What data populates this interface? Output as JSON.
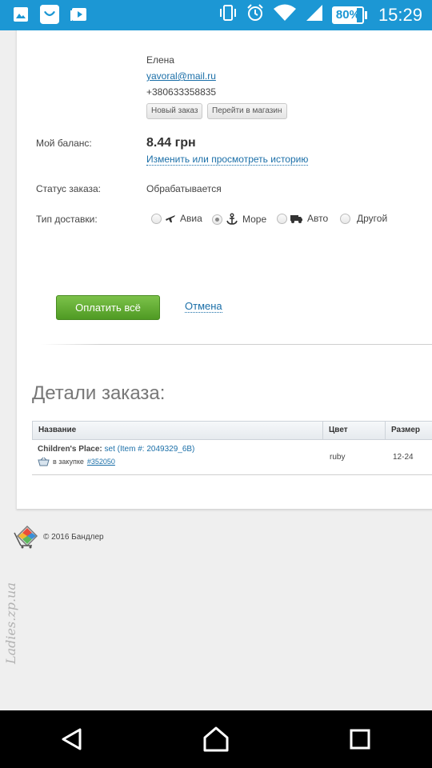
{
  "status_bar": {
    "battery_percent": 80,
    "battery_text": "80%",
    "time": "15:29",
    "icons": [
      "gallery-icon",
      "shopping-bag-icon",
      "media-icon",
      "vibrate-icon",
      "alarm-icon",
      "wifi-icon",
      "signal-icon",
      "battery-icon"
    ]
  },
  "customer": {
    "name": "Елена",
    "email": "yavoral@mail.ru",
    "phone": "+380633358835",
    "new_order_label": "Новый заказ",
    "go_to_shop_label": "Перейти в магазин"
  },
  "balance": {
    "label": "Мой баланс:",
    "value": "8.44 грн",
    "history_link": "Изменить или просмотреть историю"
  },
  "order_status": {
    "label": "Статус заказа:",
    "value": "Обрабатывается"
  },
  "delivery": {
    "label": "Тип доставки:",
    "options": [
      {
        "label": "Авиа",
        "icon": "airplane-icon",
        "checked": false
      },
      {
        "label": "Море",
        "icon": "anchor-icon",
        "checked": true
      },
      {
        "label": "Авто",
        "icon": "truck-icon",
        "checked": false
      },
      {
        "label": "Другой",
        "icon": "",
        "checked": false
      }
    ]
  },
  "actions": {
    "pay_all": "Оплатить всё",
    "cancel": "Отмена"
  },
  "details": {
    "title": "Детали заказа:",
    "columns": [
      "Название",
      "Цвет",
      "Размер"
    ],
    "rows": [
      {
        "shop": "Children's Place:",
        "item": "set (Item #: 2049329_6B)",
        "purchase_prefix": "в закупке",
        "purchase_link": "#352050",
        "color": "ruby",
        "size": "12-24"
      }
    ]
  },
  "footer": {
    "copyright": "© 2016 Бандлер"
  },
  "watermark": "Ladies.zp.ua",
  "colors": {
    "status_bar": "#1c97d4",
    "link": "#1b6fa8",
    "pay_button": "#5ea72f"
  }
}
